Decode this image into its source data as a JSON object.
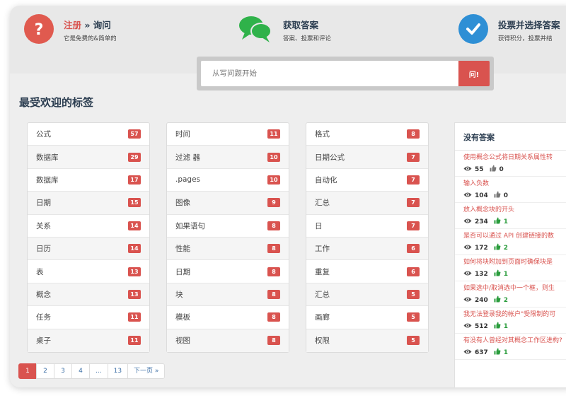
{
  "hero": {
    "steps": [
      {
        "accent": "注册",
        "sep": " » ",
        "title": "询问",
        "sub": "它是免费的&简单的",
        "icon": "question-icon",
        "color": "#e05a4f"
      },
      {
        "title": "获取答案",
        "sub": "答案、投票和评论",
        "icon": "chat-bubbles-icon",
        "color": "#2fb24a"
      },
      {
        "title": "投票并选择答案",
        "sub": "获得积分，投票并结",
        "icon": "checkmark-icon",
        "color": "#2e8fd5"
      }
    ]
  },
  "search": {
    "placeholder": "从写问题开始",
    "button_label": "问!"
  },
  "tags_section": {
    "title": "最受欢迎的标签"
  },
  "tag_columns": [
    [
      {
        "name": "公式",
        "count": "57"
      },
      {
        "name": "数据库",
        "count": "29"
      },
      {
        "name": "数据库",
        "count": "17"
      },
      {
        "name": "日期",
        "count": "15"
      },
      {
        "name": "关系",
        "count": "14"
      },
      {
        "name": "日历",
        "count": "14"
      },
      {
        "name": "表",
        "count": "13"
      },
      {
        "name": "概念",
        "count": "13"
      },
      {
        "name": "任务",
        "count": "11"
      },
      {
        "name": "桌子",
        "count": "11"
      }
    ],
    [
      {
        "name": "时间",
        "count": "11"
      },
      {
        "name": "过滤 器",
        "count": "10"
      },
      {
        "name": ".pages",
        "count": "10"
      },
      {
        "name": "图像",
        "count": "9"
      },
      {
        "name": "如果语句",
        "count": "8"
      },
      {
        "name": "性能",
        "count": "8"
      },
      {
        "name": "日期",
        "count": "8"
      },
      {
        "name": "块",
        "count": "8"
      },
      {
        "name": "模板",
        "count": "8"
      },
      {
        "name": "视图",
        "count": "8"
      }
    ],
    [
      {
        "name": "格式",
        "count": "8"
      },
      {
        "name": "日期公式",
        "count": "7"
      },
      {
        "name": "自动化",
        "count": "7"
      },
      {
        "name": "汇总",
        "count": "7"
      },
      {
        "name": "日",
        "count": "7"
      },
      {
        "name": "工作",
        "count": "6"
      },
      {
        "name": "重复",
        "count": "6"
      },
      {
        "name": "汇总",
        "count": "5"
      },
      {
        "name": "画廊",
        "count": "5"
      },
      {
        "name": "权限",
        "count": "5"
      }
    ]
  ],
  "pagination": [
    "1",
    "2",
    "3",
    "4",
    "...",
    "13",
    "下一页 »"
  ],
  "unanswered": {
    "title": "没有答案",
    "items": [
      {
        "q": "使用概念公式将日期关系属性转",
        "views": "55",
        "votes": "0",
        "up": false
      },
      {
        "q": "输入负数",
        "views": "104",
        "votes": "0",
        "up": false
      },
      {
        "q": "放入概念块的开头",
        "views": "234",
        "votes": "1",
        "up": true
      },
      {
        "q": "是否可以通过 API 创建链接的数",
        "views": "172",
        "votes": "2",
        "up": true
      },
      {
        "q": "如何将块附加到页面时确保块是",
        "views": "132",
        "votes": "1",
        "up": true
      },
      {
        "q": "如果选中/取消选中一个框，则生",
        "views": "240",
        "votes": "2",
        "up": true
      },
      {
        "q": "我无法登录我的帐户\"受限制的可",
        "views": "512",
        "votes": "1",
        "up": true
      },
      {
        "q": "有没有人曾经对其概念工作区进构?",
        "views": "637",
        "votes": "1",
        "up": true,
        "wrap": true
      }
    ]
  }
}
